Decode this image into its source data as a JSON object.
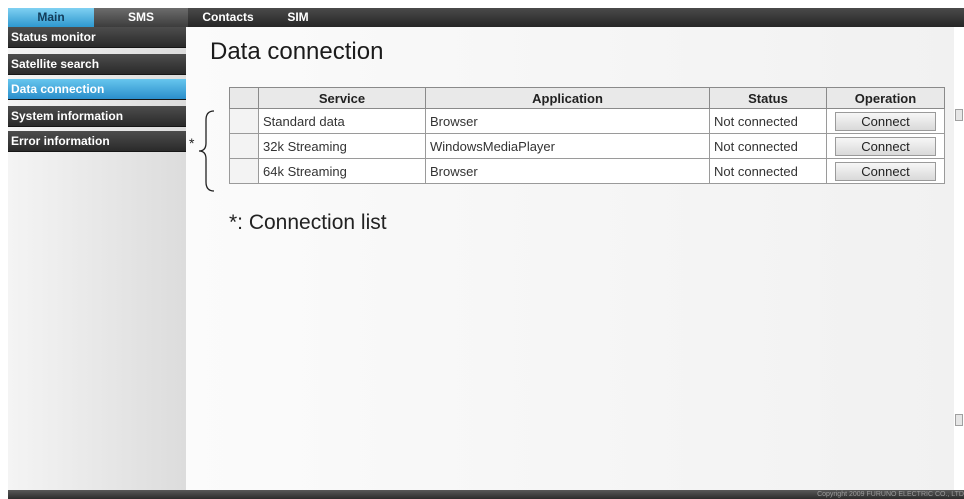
{
  "nav": {
    "tabs": [
      {
        "label": "Main"
      },
      {
        "label": "SMS"
      },
      {
        "label": "Contacts"
      },
      {
        "label": "SIM"
      }
    ]
  },
  "sidebar": {
    "items": [
      {
        "label": "Status monitor"
      },
      {
        "label": "Satellite search"
      },
      {
        "label": "Data connection"
      },
      {
        "label": "System information"
      },
      {
        "label": "Error information"
      }
    ]
  },
  "page": {
    "title": "Data connection"
  },
  "table": {
    "headers": [
      "Service",
      "Application",
      "Status",
      "Operation"
    ],
    "rows": [
      {
        "service": "Standard data",
        "application": "Browser",
        "status": "Not connected",
        "operation": "Connect"
      },
      {
        "service": "32k Streaming",
        "application": "WindowsMediaPlayer",
        "status": "Not connected",
        "operation": "Connect"
      },
      {
        "service": "64k Streaming",
        "application": "Browser",
        "status": "Not connected",
        "operation": "Connect"
      }
    ]
  },
  "annotation": {
    "marker": "*",
    "note": "*: Connection list"
  },
  "footer": {
    "copyright": "Copyright 2009 FURUNO ELECTRIC CO., LTD"
  },
  "colors": {
    "accent": "#2e98cf",
    "nav_background": "#333333"
  }
}
